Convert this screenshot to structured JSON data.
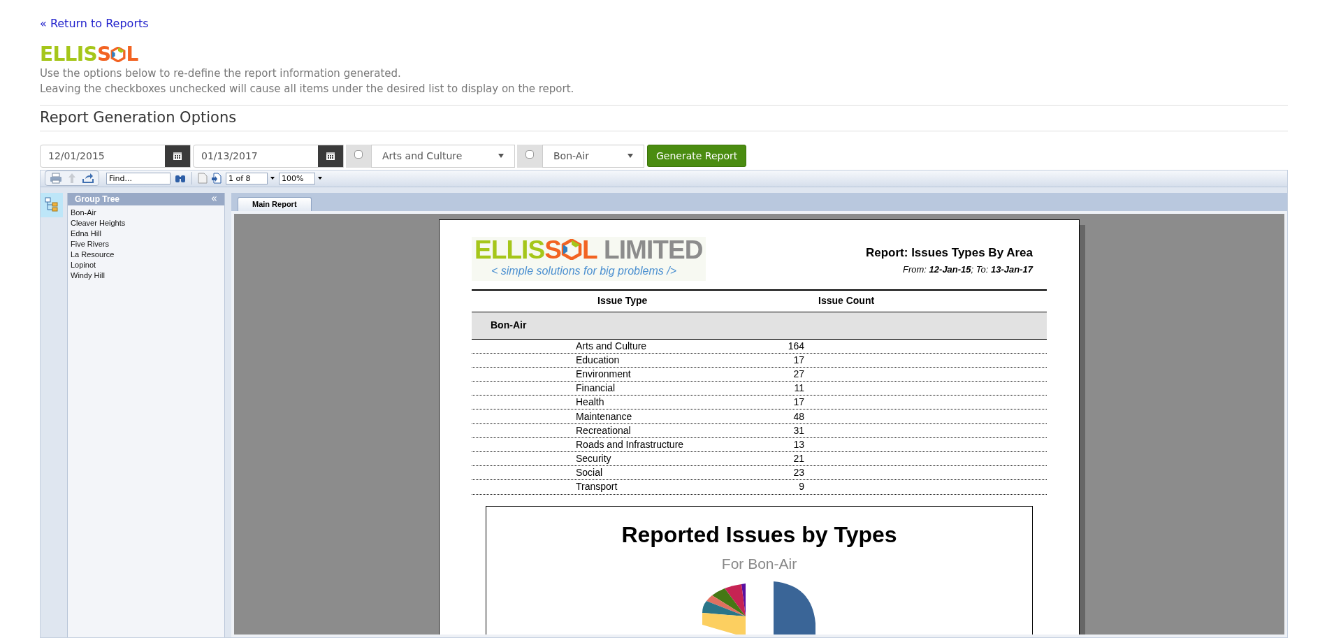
{
  "back_link": "« Return to Reports",
  "logo": [
    {
      "kind": "text",
      "text": "ELLIS",
      "color": "#a5c61a"
    },
    {
      "kind": "text",
      "text": "S",
      "color": "#f26322"
    },
    {
      "kind": "hex"
    },
    {
      "kind": "text",
      "text": "L",
      "color": "#f26322"
    }
  ],
  "description": [
    "Use the options below to re-define the report information generated.",
    "Leaving the checkboxes unchecked will cause all items under the desired list to display on the report."
  ],
  "section_title": "Report Generation Options",
  "filters": {
    "start_date": "12/01/2015",
    "end_date": "01/13/2017",
    "issue_type": {
      "checked": false,
      "value": "Arts and Culture"
    },
    "area": {
      "checked": false,
      "value": "Bon-Air"
    },
    "button": "Generate Report"
  },
  "viewer_toolbar": {
    "find_placeholder": "Find...",
    "page": "1 of 8",
    "zoom": "100%"
  },
  "group_tree": {
    "title": "Group Tree",
    "collapse": "«",
    "items": [
      "Bon-Air",
      "Cleaver Heights",
      "Edna Hill",
      "Five Rivers",
      "La Resource",
      "Lopinot",
      "Windy Hill"
    ]
  },
  "tabs": [
    {
      "label": "Main Report",
      "selected": true
    }
  ],
  "report": {
    "logo": [
      {
        "kind": "text",
        "text": "ELLIS",
        "color": "#a5c61a"
      },
      {
        "kind": "text",
        "text": "S",
        "color": "#f26322"
      },
      {
        "kind": "hex"
      },
      {
        "kind": "text",
        "text": "L",
        "color": "#f26322"
      },
      {
        "kind": "text",
        "text": " LIMITED",
        "color": "#8c8c8c"
      }
    ],
    "tagline": "< simple solutions for big problems />",
    "title": "Report: Issues Types By Area",
    "date_range": "From: **12-Jan-15**; To: **13-Jan-17**",
    "columns": [
      "Issue Type",
      "Issue Count"
    ],
    "group": "Bon-Air",
    "rows": [
      {
        "type": "Arts and Culture",
        "count": "164"
      },
      {
        "type": "Education",
        "count": "17"
      },
      {
        "type": "Environment",
        "count": "27"
      },
      {
        "type": "Financial",
        "count": "11"
      },
      {
        "type": "Health",
        "count": "17"
      },
      {
        "type": "Maintenance",
        "count": "48"
      },
      {
        "type": "Recreational",
        "count": "31"
      },
      {
        "type": "Roads and Infrastructure",
        "count": "13"
      },
      {
        "type": "Security",
        "count": "21"
      },
      {
        "type": "Social",
        "count": "23"
      },
      {
        "type": "Transport",
        "count": "9"
      }
    ],
    "chart_title": "Reported Issues by Types",
    "chart_subtitle": "For Bon-Air"
  }
}
